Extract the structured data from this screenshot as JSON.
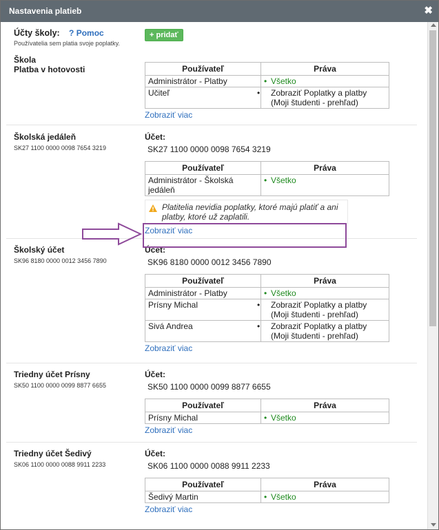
{
  "dialog": {
    "title": "Nastavenia platieb",
    "close_symbol": "✖"
  },
  "header": {
    "label": "Účty školy:",
    "help_label": "? Pomoc",
    "subtitle": "Používatelia sem platia svoje poplatky.",
    "add_button": "+ pridať"
  },
  "table_headers": {
    "user": "Používateľ",
    "rights": "Práva"
  },
  "labels": {
    "account": "Účet:",
    "show_more": "Zobraziť viac"
  },
  "accounts": [
    {
      "name_line1": "Škola",
      "name_line2": "Platba v hotovosti",
      "rows": [
        {
          "user": "Administrátor - Platby",
          "rights": "Všetko",
          "green": true
        },
        {
          "user": "Učiteľ",
          "rights": "Zobraziť Poplatky a platby (Moji študenti - prehľad)",
          "green": false
        }
      ]
    },
    {
      "name": "Školská jedáleň",
      "iban": "SK27 1100 0000 0098 7654 3219",
      "account_value": "SK27 1100 0000 0098 7654 3219",
      "rows": [
        {
          "user": "Administrátor - Školská jedáleň",
          "rights": "Všetko",
          "green": true
        }
      ],
      "warning": "Platitelia nevidia poplatky, ktoré majú platiť a ani platby, ktoré už zaplatili."
    },
    {
      "name": "Školský účet",
      "iban": "SK96 8180 0000 0012 3456 7890",
      "account_value": "SK96 8180 0000 0012 3456 7890",
      "rows": [
        {
          "user": "Administrátor - Platby",
          "rights": "Všetko",
          "green": true
        },
        {
          "user": "Prísny Michal",
          "rights": "Zobraziť Poplatky a platby (Moji študenti - prehľad)",
          "green": false
        },
        {
          "user": "Sivá Andrea",
          "rights": "Zobraziť Poplatky a platby (Moji študenti - prehľad)",
          "green": false
        }
      ]
    },
    {
      "name": "Triedny účet Prísny",
      "iban": "SK50 1100 0000 0099 8877 6655",
      "account_value": "SK50 1100 0000 0099 8877 6655",
      "rows": [
        {
          "user": "Prísny Michal",
          "rights": "Všetko",
          "green": true
        }
      ]
    },
    {
      "name": "Triedny účet Šedivý",
      "iban": "SK06 1100 0000 0088 9911 2233",
      "account_value": "SK06 1100 0000 0088 9911 2233",
      "rows": [
        {
          "user": "Šedivý Martin",
          "rights": "Všetko",
          "green": true
        }
      ]
    }
  ],
  "colors": {
    "titlebar": "#606a72",
    "accent_green": "#5cb85c",
    "link_blue": "#2f6fbd",
    "highlight_purple": "#8e4a9a"
  }
}
